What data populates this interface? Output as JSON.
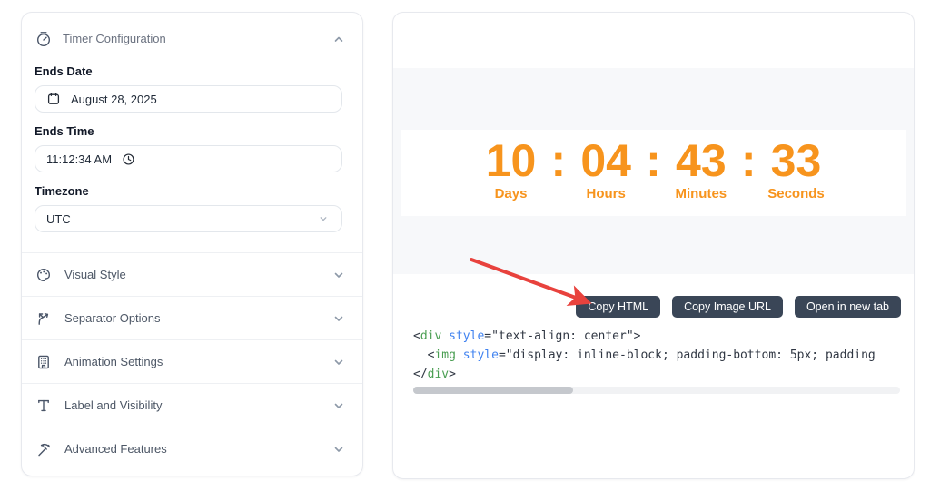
{
  "theme": {
    "accent_orange": "#f7941d",
    "button_bg": "#3a4657",
    "arrow_red": "#e8423d",
    "code_tag_green": "#4a9e52",
    "code_attr_blue": "#4183f0"
  },
  "left_panel": {
    "header": {
      "title": "Timer Configuration"
    },
    "fields": {
      "ends_date": {
        "label": "Ends Date",
        "value": "August 28, 2025"
      },
      "ends_time": {
        "label": "Ends Time",
        "value": "11:12:34 AM"
      },
      "timezone": {
        "label": "Timezone",
        "value": "UTC"
      }
    },
    "collapsed_sections": [
      {
        "label": "Visual Style"
      },
      {
        "label": "Separator Options"
      },
      {
        "label": "Animation Settings"
      },
      {
        "label": "Label and Visibility"
      },
      {
        "label": "Advanced Features"
      }
    ]
  },
  "preview": {
    "timer": {
      "separator": ":",
      "units": [
        {
          "value": "10",
          "label": "Days"
        },
        {
          "value": "04",
          "label": "Hours"
        },
        {
          "value": "43",
          "label": "Minutes"
        },
        {
          "value": "33",
          "label": "Seconds"
        }
      ]
    },
    "buttons": [
      {
        "label": "Copy HTML"
      },
      {
        "label": "Copy Image URL"
      },
      {
        "label": "Open in new tab"
      }
    ],
    "code_lines": [
      [
        [
          "pln",
          "<"
        ],
        [
          "tag",
          "div"
        ],
        [
          "pln",
          " "
        ],
        [
          "atr",
          "style"
        ],
        [
          "pln",
          "=\"text-align: center\">"
        ]
      ],
      [
        [
          "pln",
          "  <"
        ],
        [
          "tag",
          "img"
        ],
        [
          "pln",
          " "
        ],
        [
          "atr",
          "style"
        ],
        [
          "pln",
          "=\"display: inline-block; padding-bottom: 5px; padding"
        ]
      ],
      [
        [
          "pln",
          "</"
        ],
        [
          "tag",
          "div"
        ],
        [
          "pln",
          ">"
        ]
      ]
    ]
  }
}
